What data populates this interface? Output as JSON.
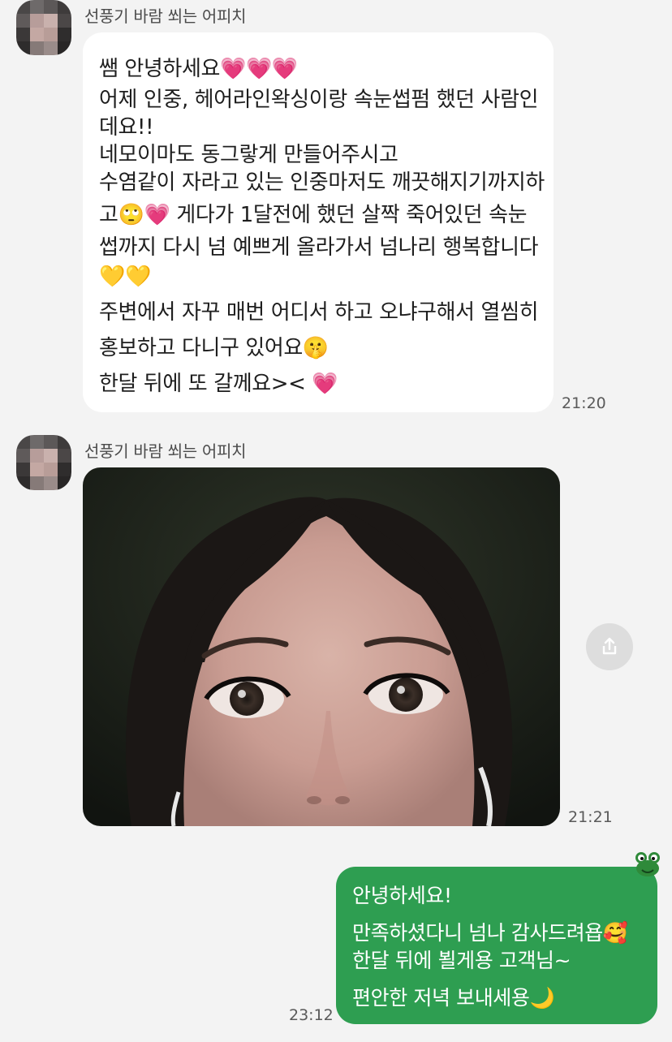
{
  "messages": {
    "first": {
      "sender": "선풍기 바람 쐬는 어피치",
      "lines": [
        "쌤 안녕하세요💗💗💗",
        "어제 인중, 헤어라인왁싱이랑 속눈썹펌 했던 사람인",
        "데요!!",
        "네모이마도 동그랗게 만들어주시고",
        "수염같이 자라고 있는 인중마저도 깨끗해지기까지하",
        "고🙄💗 게다가 1달전에 했던 살짝 죽어있던 속눈",
        "썹까지 다시 넘 예쁘게 올라가서 넘나리 행복합니다",
        "💛💛",
        "주변에서 자꾸 매번 어디서 하고 오냐구해서 열씸히",
        "홍보하고 다니구 있어요🤫",
        "한달 뒤에 또 갈께요>< 💗"
      ],
      "time": "21:20"
    },
    "second": {
      "sender": "선풍기 바람 쐬는 어피치",
      "time": "21:21",
      "share_icon": "share-icon"
    },
    "reply": {
      "lines": [
        "안녕하세요!",
        "만족하셨다니 넘나 감사드려욥🥰",
        "한달 뒤에 뵐게용 고객님~",
        "편안한 저녁 보내세용🌙"
      ],
      "time": "23:12"
    }
  },
  "colors": {
    "background": "#f3f3f3",
    "incoming_bubble": "#ffffff",
    "outgoing_bubble": "#2e9e51",
    "time_text": "#5a5a5a"
  }
}
